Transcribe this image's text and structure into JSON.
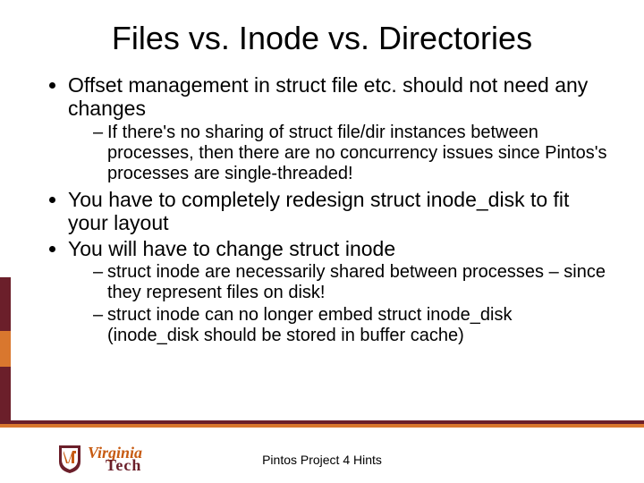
{
  "title": "Files vs. Inode vs. Directories",
  "bullets": {
    "b1": "Offset management in struct file etc. should not need any changes",
    "b1s1": "If there's no sharing of struct file/dir instances between processes, then there are no concurrency issues since Pintos's processes are single-threaded!",
    "b2": "You have to completely redesign struct inode_disk to fit your layout",
    "b3": "You will have to change struct inode",
    "b3s1": "struct inode are necessarily shared between processes – since they represent files on disk!",
    "b3s2": "struct inode can no longer embed struct inode_disk (inode_disk should be stored in buffer cache)"
  },
  "footer": "Pintos Project 4 Hints",
  "logo": {
    "line1": "Virginia",
    "line2": "Tech"
  },
  "colors": {
    "maroon": "#6b1f2a",
    "orange": "#d9772e"
  }
}
